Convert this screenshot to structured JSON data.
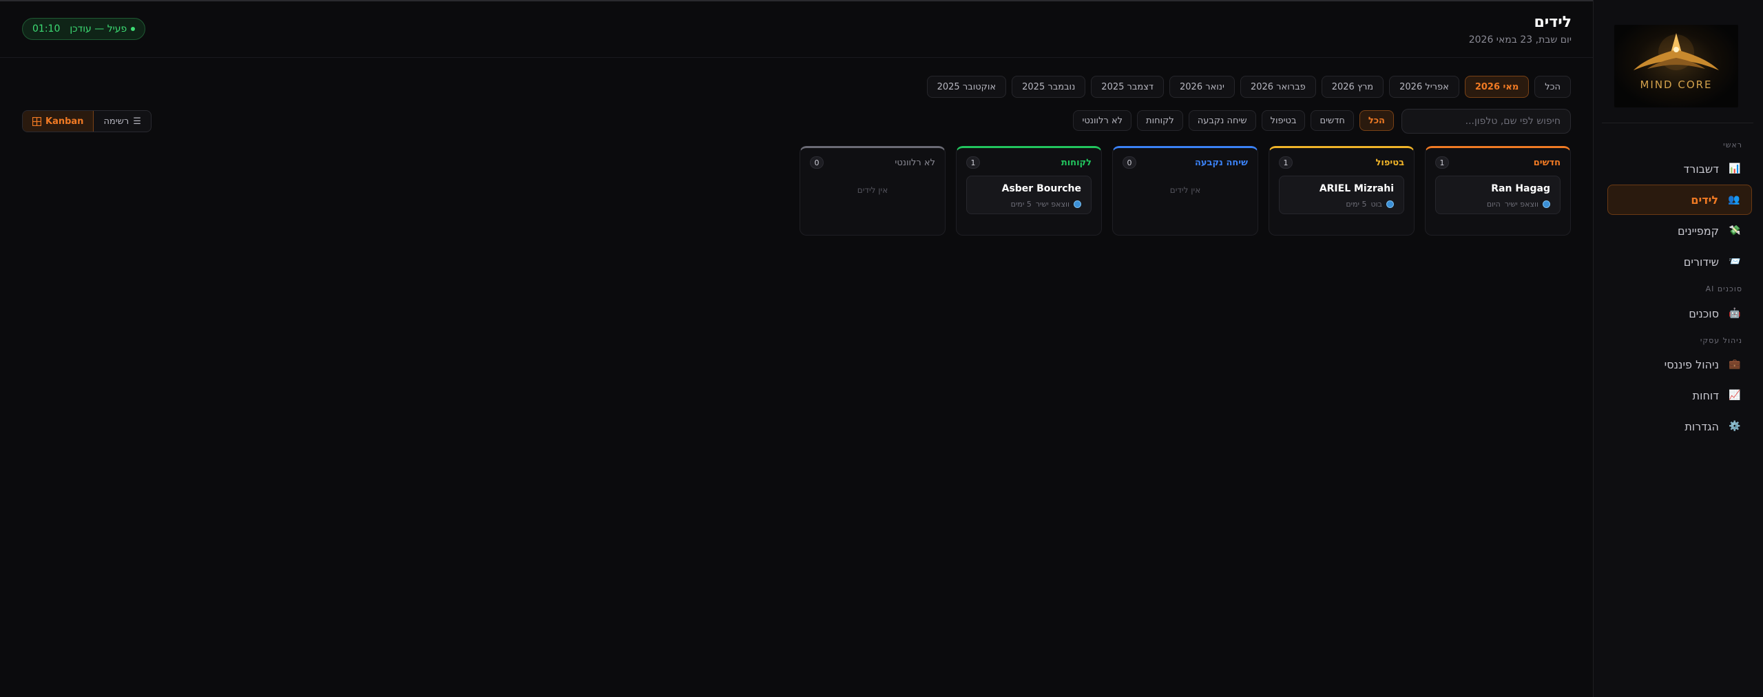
{
  "sidebar": {
    "logo_text": "MIND CORE",
    "section_main": "ראשי",
    "section_ai": "סוכנים AI",
    "section_business": "ניהול עסקי",
    "items": [
      {
        "label": "דשבורד",
        "icon": "chart-icon"
      },
      {
        "label": "לידים",
        "icon": "users-icon"
      },
      {
        "label": "קמפיינים",
        "icon": "megaphone-icon"
      },
      {
        "label": "שידורים",
        "icon": "broadcast-icon"
      },
      {
        "label": "סוכנים",
        "icon": "robot-icon"
      },
      {
        "label": "ניהול פיננסי",
        "icon": "briefcase-icon"
      },
      {
        "label": "דוחות",
        "icon": "trend-icon"
      },
      {
        "label": "הגדרות",
        "icon": "gear-icon"
      }
    ]
  },
  "header": {
    "title": "לידים",
    "subtitle": "יום שבת, 23 במאי 2026",
    "status_label": "פעיל — עודכן",
    "status_time": "01:10"
  },
  "months": [
    "הכל",
    "מאי 2026",
    "אפריל 2026",
    "מרץ 2026",
    "פברואר 2026",
    "ינואר 2026",
    "דצמבר 2025",
    "נובמבר 2025",
    "אוקטובר 2025"
  ],
  "search": {
    "placeholder": "חיפוש לפי שם, טלפון..."
  },
  "filters": [
    "הכל",
    "חדשים",
    "בטיפול",
    "שיחה נקבעה",
    "לקוחות",
    "לא רלוונטי"
  ],
  "view_toggle": {
    "list_label": "רשימה",
    "kanban_label": "Kanban"
  },
  "columns": [
    {
      "title": "חדשים",
      "count": "1",
      "color": "#f07a24",
      "lead": {
        "name": "Ran Hagag",
        "source": "ווצאפ ישיר",
        "age": "היום"
      }
    },
    {
      "title": "בטיפול",
      "count": "1",
      "color": "#f0b429",
      "lead": {
        "name": "ARIEL Mizrahi",
        "source": "בוט",
        "age": "5 ימים"
      }
    },
    {
      "title": "שיחה נקבעה",
      "count": "0",
      "color": "#3b82f6",
      "empty": "אין לידים"
    },
    {
      "title": "לקוחות",
      "count": "1",
      "color": "#22c55e",
      "lead": {
        "name": "Asber Bourche",
        "source": "ווצאפ ישיר",
        "age": "5 ימים"
      }
    },
    {
      "title": "לא רלוונטי",
      "count": "0",
      "color": "#6b6b75",
      "empty": "אין לידים"
    }
  ]
}
